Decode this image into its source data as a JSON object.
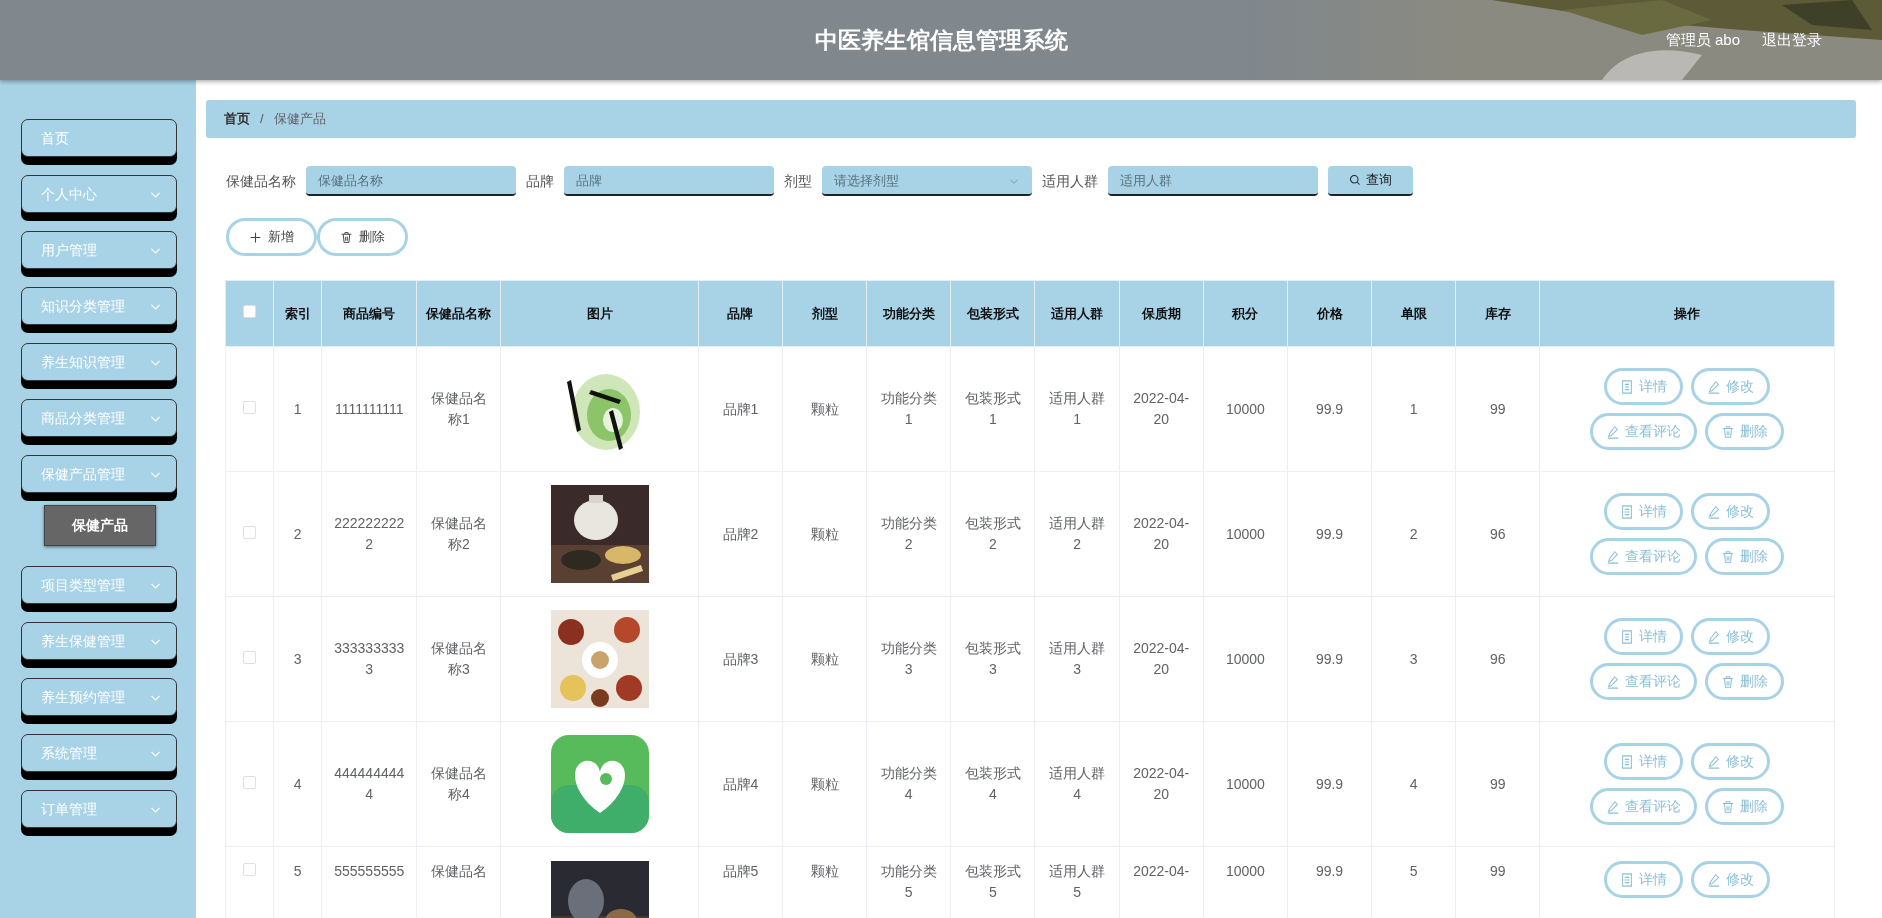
{
  "header": {
    "title": "中医养生馆信息管理系统",
    "user": "管理员 abo",
    "logout": "退出登录"
  },
  "sidebar": {
    "items": [
      {
        "label": "首页",
        "kind": "link"
      },
      {
        "label": "个人中心",
        "kind": "menu"
      },
      {
        "label": "用户管理",
        "kind": "menu"
      },
      {
        "label": "知识分类管理",
        "kind": "menu"
      },
      {
        "label": "养生知识管理",
        "kind": "menu"
      },
      {
        "label": "商品分类管理",
        "kind": "menu"
      },
      {
        "label": "保健产品管理",
        "kind": "menu",
        "children": [
          {
            "label": "保健产品"
          }
        ]
      },
      {
        "label": "项目类型管理",
        "kind": "menu"
      },
      {
        "label": "养生保健管理",
        "kind": "menu"
      },
      {
        "label": "养生预约管理",
        "kind": "menu"
      },
      {
        "label": "系统管理",
        "kind": "menu"
      },
      {
        "label": "订单管理",
        "kind": "menu"
      }
    ]
  },
  "breadcrumb": {
    "items": [
      "首页",
      "保健产品"
    ],
    "separator": "/"
  },
  "search": {
    "fields": [
      {
        "label": "保健品名称",
        "kind": "text",
        "placeholder": "保健品名称"
      },
      {
        "label": "品牌",
        "kind": "text",
        "placeholder": "品牌"
      },
      {
        "label": "剂型",
        "kind": "select",
        "placeholder": "请选择剂型"
      },
      {
        "label": "适用人群",
        "kind": "text",
        "placeholder": "适用人群"
      }
    ],
    "button": "查询"
  },
  "toolbar": [
    "新增",
    "删除"
  ],
  "table": {
    "all_selected": false,
    "columns": [
      "索引",
      "商品编号",
      "保健品名称",
      "图片",
      "品牌",
      "剂型",
      "功能分类",
      "包装形式",
      "适用人群",
      "保质期",
      "积分",
      "价格",
      "单限",
      "库存",
      "操作"
    ],
    "rows": [
      {
        "selected": false,
        "cells": [
          "1",
          "1111111111",
          "保健品名称1",
          {
            "kind": "picture"
          },
          "品牌1",
          "颗粒",
          "功能分类1",
          "包装形式1",
          "适用人群1",
          "2022-04-20",
          "10000",
          "99.9",
          "1",
          "99"
        ],
        "actions": [
          "详情",
          "修改",
          "查看评论",
          "删除"
        ]
      },
      {
        "selected": false,
        "cells": [
          "2",
          "2222222222",
          "保健品名称2",
          {
            "kind": "picture"
          },
          "品牌2",
          "颗粒",
          "功能分类2",
          "包装形式2",
          "适用人群2",
          "2022-04-20",
          "10000",
          "99.9",
          "2",
          "96"
        ],
        "actions": [
          "详情",
          "修改",
          "查看评论",
          "删除"
        ]
      },
      {
        "selected": false,
        "cells": [
          "3",
          "3333333333",
          "保健品名称3",
          {
            "kind": "picture"
          },
          "品牌3",
          "颗粒",
          "功能分类3",
          "包装形式3",
          "适用人群3",
          "2022-04-20",
          "10000",
          "99.9",
          "3",
          "96"
        ],
        "actions": [
          "详情",
          "修改",
          "查看评论",
          "删除"
        ]
      },
      {
        "selected": false,
        "cells": [
          "4",
          "4444444444",
          "保健品名称4",
          {
            "kind": "picture"
          },
          "品牌4",
          "颗粒",
          "功能分类4",
          "包装形式4",
          "适用人群4",
          "2022-04-20",
          "10000",
          "99.9",
          "4",
          "99"
        ],
        "actions": [
          "详情",
          "修改",
          "查看评论",
          "删除"
        ]
      },
      {
        "selected": false,
        "cells": [
          "5",
          "555555555",
          "保健品名",
          {
            "kind": "picture"
          },
          "品牌5",
          "颗粒",
          "功能分类5",
          "包装形式5",
          "适用人群5",
          "2022-04-",
          "10000",
          "99.9",
          "5",
          "99"
        ],
        "actions": [
          "详情",
          "修改"
        ]
      }
    ]
  }
}
